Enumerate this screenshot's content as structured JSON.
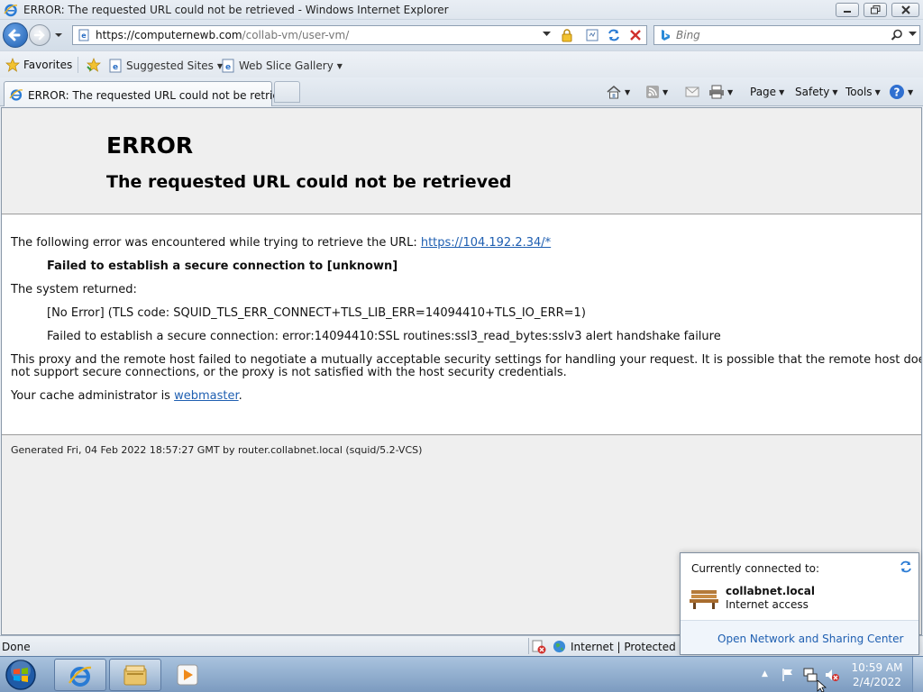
{
  "window": {
    "title": "ERROR: The requested URL could not be retrieved - Windows Internet Explorer"
  },
  "address_bar": {
    "url_base": "https://computernewb.com",
    "url_path": "/collab-vm/user-vm/"
  },
  "search": {
    "placeholder": "Bing"
  },
  "favorites_bar": {
    "favorites_label": "Favorites",
    "suggested_sites_label": "Suggested Sites",
    "web_slice_gallery_label": "Web Slice Gallery"
  },
  "tab": {
    "label": "ERROR: The requested URL could not be retrieved"
  },
  "command_bar": {
    "page_label": "Page",
    "safety_label": "Safety",
    "tools_label": "Tools"
  },
  "page": {
    "heading": "ERROR",
    "subheading": "The requested URL could not be retrieved",
    "intro_text": "The following error was encountered while trying to retrieve the URL:",
    "intro_url": "https://104.192.2.34/*",
    "failure_summary": "Failed to establish a secure connection to [unknown]",
    "system_returned": "The system returned:",
    "error_code_line": "[No Error] (TLS code: SQUID_TLS_ERR_CONNECT+TLS_LIB_ERR=14094410+TLS_IO_ERR=1)",
    "error_detail_line": "Failed to establish a secure connection: error:14094410:SSL routines:ssl3_read_bytes:sslv3 alert handshake failure",
    "explanation_line1": "This proxy and the remote host failed to negotiate a mutually acceptable security settings for handling your request. It is possible that the remote host does",
    "explanation_line2": "not support secure connections, or the proxy is not satisfied with the host security credentials.",
    "admin_text": "Your cache administrator is",
    "admin_link": "webmaster",
    "admin_suffix": ".",
    "footer": "Generated Fri, 04 Feb 2022 18:57:27 GMT by router.collabnet.local (squid/5.2-VCS)"
  },
  "status_bar": {
    "status_text": "Done",
    "zone_text": "Internet | Protected Mo"
  },
  "network_popup": {
    "heading": "Currently connected to:",
    "network_name": "collabnet.local",
    "network_status": "Internet access",
    "open_link": "Open Network and Sharing Center"
  },
  "taskbar": {
    "time": "10:59 AM",
    "date": "2/4/2022"
  }
}
